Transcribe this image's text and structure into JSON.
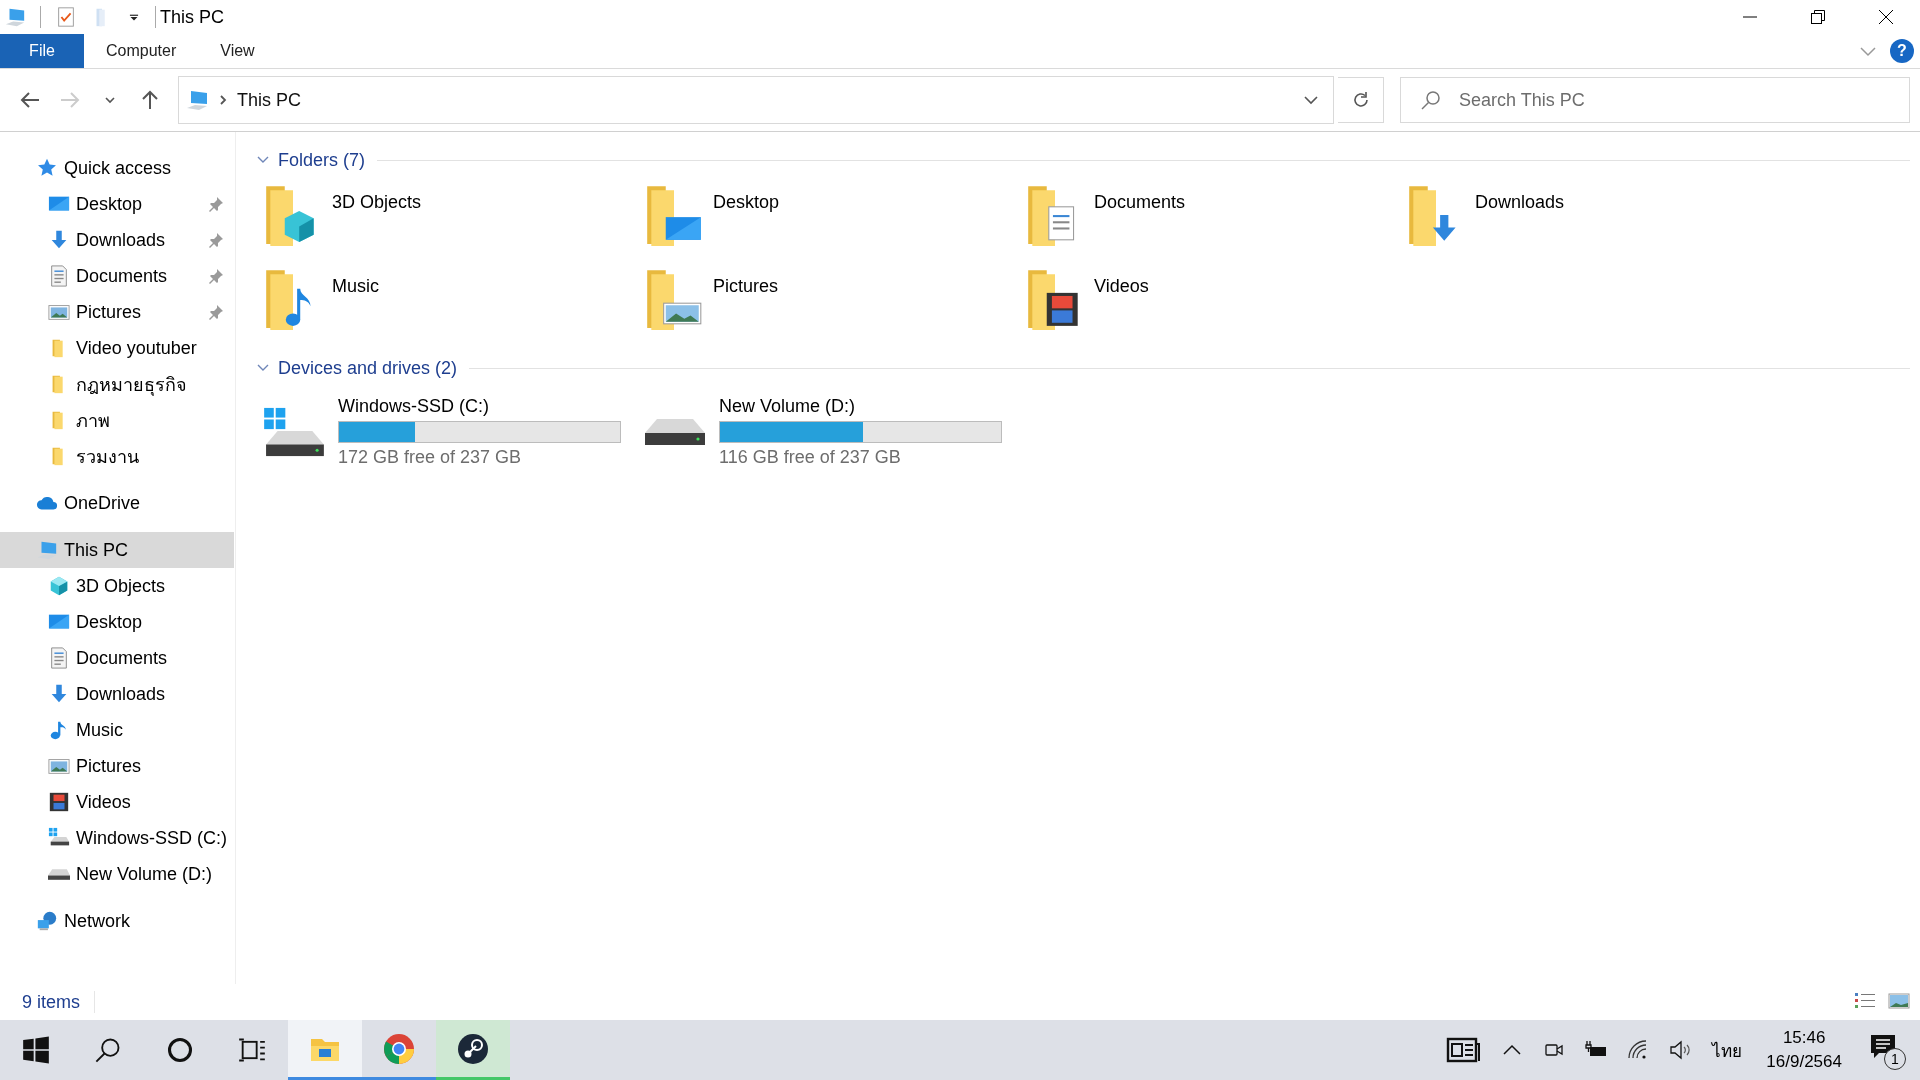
{
  "window": {
    "title": "This PC"
  },
  "ribbon": {
    "file_button": "File",
    "tabs": [
      {
        "label": "Computer",
        "selected": false
      },
      {
        "label": "View",
        "selected": false
      }
    ],
    "help": "?"
  },
  "address_bar": {
    "path": [
      "This PC"
    ],
    "search_placeholder": "Search This PC"
  },
  "sidebar": {
    "items": [
      {
        "label": "Quick access",
        "kind": "star",
        "selected": false,
        "children": [
          {
            "label": "Desktop",
            "kind": "desktop",
            "pinned": true,
            "selected": false
          },
          {
            "label": "Downloads",
            "kind": "download",
            "pinned": true,
            "selected": false
          },
          {
            "label": "Documents",
            "kind": "document",
            "pinned": true,
            "selected": false
          },
          {
            "label": "Pictures",
            "kind": "picture",
            "pinned": true,
            "selected": false
          },
          {
            "label": "Video youtuber",
            "kind": "folder",
            "pinned": false,
            "selected": false
          },
          {
            "label": "กฎหมายธุรกิจ",
            "kind": "folder",
            "pinned": false,
            "selected": false
          },
          {
            "label": "ภาพ",
            "kind": "folder",
            "pinned": false,
            "selected": false
          },
          {
            "label": "รวมงาน",
            "kind": "folder",
            "pinned": false,
            "selected": false
          }
        ]
      },
      {
        "label": "OneDrive",
        "kind": "cloud",
        "selected": false
      },
      {
        "label": "This PC",
        "kind": "computer",
        "selected": true,
        "children": [
          {
            "label": "3D Objects",
            "kind": "cube",
            "pinned": false,
            "selected": false
          },
          {
            "label": "Desktop",
            "kind": "desktop",
            "pinned": false,
            "selected": false
          },
          {
            "label": "Documents",
            "kind": "document",
            "pinned": false,
            "selected": false
          },
          {
            "label": "Downloads",
            "kind": "download",
            "pinned": false,
            "selected": false
          },
          {
            "label": "Music",
            "kind": "music",
            "pinned": false,
            "selected": false
          },
          {
            "label": "Pictures",
            "kind": "picture",
            "pinned": false,
            "selected": false
          },
          {
            "label": "Videos",
            "kind": "film",
            "pinned": false,
            "selected": false
          },
          {
            "label": "Windows-SSD (C:)",
            "kind": "system-drive",
            "pinned": false,
            "selected": false
          },
          {
            "label": "New Volume (D:)",
            "kind": "drive",
            "pinned": false,
            "selected": false
          }
        ]
      },
      {
        "label": "Network",
        "kind": "network",
        "selected": false
      }
    ]
  },
  "content": {
    "groups": [
      {
        "title": "Folders (7)",
        "expanded": true,
        "kind": "folders",
        "items": [
          {
            "name": "3D Objects",
            "kind": "cube"
          },
          {
            "name": "Desktop",
            "kind": "desktop"
          },
          {
            "name": "Documents",
            "kind": "document"
          },
          {
            "name": "Downloads",
            "kind": "download"
          },
          {
            "name": "Music",
            "kind": "music"
          },
          {
            "name": "Pictures",
            "kind": "picture"
          },
          {
            "name": "Videos",
            "kind": "film"
          }
        ]
      },
      {
        "title": "Devices and drives (2)",
        "expanded": true,
        "kind": "drives",
        "items": [
          {
            "name": "Windows-SSD (C:)",
            "kind": "system-drive",
            "level": 0.27,
            "free": "172 GB free of 237 GB"
          },
          {
            "name": "New Volume (D:)",
            "kind": "drive",
            "level": 0.51,
            "free": "116 GB free of 237 GB"
          }
        ]
      }
    ]
  },
  "status_bar": {
    "count": "9 items"
  },
  "taskbar": {
    "apps": [
      {
        "kind": "explorer",
        "selected": true,
        "running": true
      },
      {
        "kind": "chrome",
        "selected": false,
        "running": true
      },
      {
        "kind": "steam",
        "selected": false,
        "running": true
      }
    ],
    "language": "ไทย",
    "time": "15:46",
    "date": "16/9/2564",
    "notifications": "1"
  }
}
